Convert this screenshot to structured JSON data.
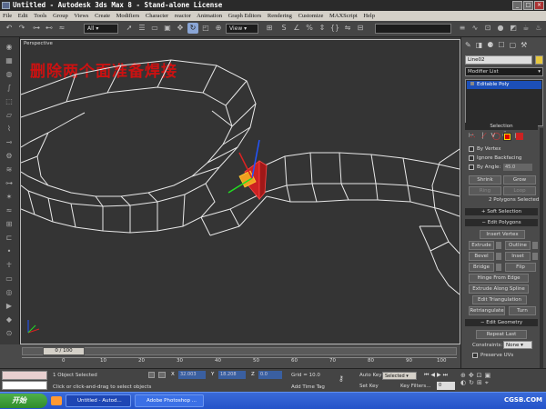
{
  "window": {
    "title": "Untitled - Autodesk 3ds Max 8  - Stand-alone License"
  },
  "menu": [
    "File",
    "Edit",
    "Tools",
    "Group",
    "Views",
    "Create",
    "Modifiers",
    "Character",
    "reactor",
    "Animation",
    "Graph Editors",
    "Rendering",
    "Customize",
    "MAXScript",
    "Help"
  ],
  "toolbar": {
    "selection_filter": "All",
    "ref_coord": "View"
  },
  "viewport": {
    "label": "Perspective",
    "caption": "删除两个面准备焊接"
  },
  "panel": {
    "object_name": "Line02",
    "modifier_list": "Modifier List",
    "stack_item": "Editable Poly",
    "selection_title": "Selection",
    "by_vertex": "By Vertex",
    "ignore_backfacing": "Ignore Backfacing",
    "by_angle": "By Angle:",
    "by_angle_value": "45.0",
    "shrink": "Shrink",
    "grow": "Grow",
    "ring": "Ring",
    "loop": "Loop",
    "selected_info": "2 Polygons Selected",
    "soft_selection": "Soft Selection",
    "edit_polygons": "Edit Polygons",
    "insert_vertex": "Insert Vertex",
    "extrude": "Extrude",
    "outline": "Outline",
    "bevel": "Bevel",
    "inset": "Inset",
    "bridge": "Bridge",
    "flip": "Flip",
    "hinge": "Hinge From Edge",
    "extrude_spline": "Extrude Along Spline",
    "edit_tri": "Edit Triangulation",
    "retriangulate": "Retriangulate",
    "turn": "Turn",
    "edit_geometry": "Edit Geometry",
    "repeat_last": "Repeat Last",
    "constraints": "Constraints:",
    "constraints_value": "None",
    "preserve_uvs": "Preserve UVs"
  },
  "timeline": {
    "frame": "0 / 100",
    "ticks": [
      "0",
      "10",
      "20",
      "30",
      "40",
      "50",
      "60",
      "70",
      "80",
      "90",
      "100"
    ]
  },
  "status": {
    "selected": "1 Object Selected",
    "prompt": "Click or click-and-drag to select objects",
    "x_label": "X",
    "x": "32.003",
    "y_label": "Y",
    "y": "18.208",
    "z_label": "Z",
    "z": "0.0",
    "grid": "Grid = 10.0",
    "add_time_tag": "Add Time Tag",
    "auto_key": "Auto Key",
    "key_mode": "Selected",
    "set_key": "Set Key",
    "key_filters": "Key Filters...",
    "frame_value": "0"
  },
  "taskbar": {
    "start": "开始",
    "tasks": [
      "Untitled - Autod...",
      "Adobe Photoshop ..."
    ],
    "watermark": "CGSB.COM"
  },
  "colors": {
    "selected_face": "#cc2222",
    "caption": "#cc1111",
    "stack_highlight": "#1c4fb8",
    "taskbar": "#2453c9",
    "start": "#3a9a35"
  }
}
